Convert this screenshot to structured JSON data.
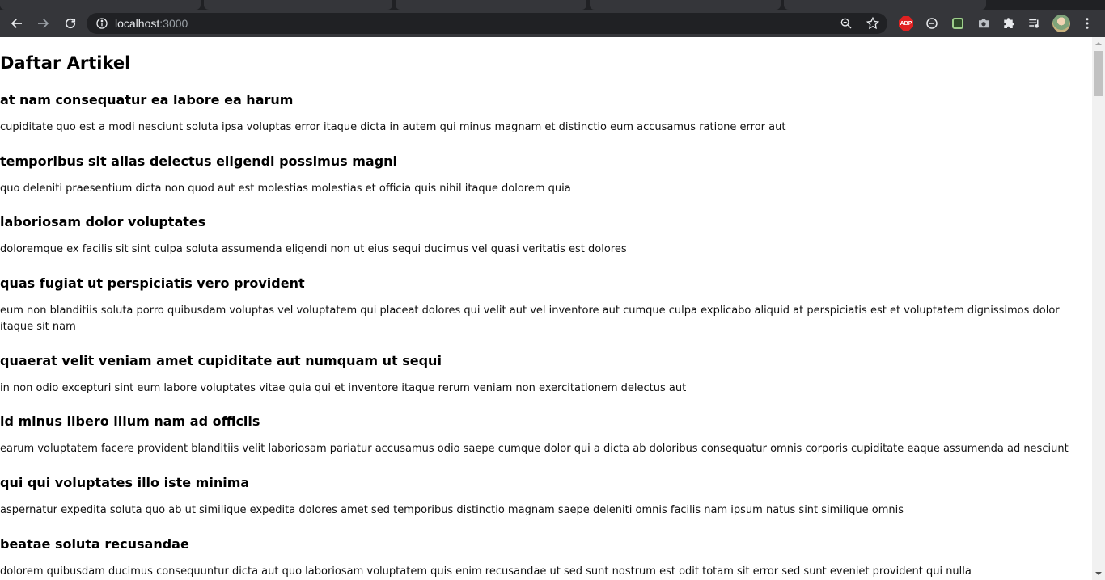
{
  "browser": {
    "url_host": "localhost",
    "url_port": ":3000"
  },
  "page": {
    "title": "Daftar Artikel",
    "articles": [
      {
        "title": "at nam consequatur ea labore ea harum",
        "body": "cupiditate quo est a modi nesciunt soluta ipsa voluptas error itaque dicta in autem qui minus magnam et distinctio eum accusamus ratione error aut"
      },
      {
        "title": "temporibus sit alias delectus eligendi possimus magni",
        "body": "quo deleniti praesentium dicta non quod aut est molestias molestias et officia quis nihil itaque dolorem quia"
      },
      {
        "title": "laboriosam dolor voluptates",
        "body": "doloremque ex facilis sit sint culpa soluta assumenda eligendi non ut eius sequi ducimus vel quasi veritatis est dolores"
      },
      {
        "title": "quas fugiat ut perspiciatis vero provident",
        "body": "eum non blanditiis soluta porro quibusdam voluptas vel voluptatem qui placeat dolores qui velit aut vel inventore aut cumque culpa explicabo aliquid at perspiciatis est et voluptatem dignissimos dolor itaque sit nam"
      },
      {
        "title": "quaerat velit veniam amet cupiditate aut numquam ut sequi",
        "body": "in non odio excepturi sint eum labore voluptates vitae quia qui et inventore itaque rerum veniam non exercitationem delectus aut"
      },
      {
        "title": "id minus libero illum nam ad officiis",
        "body": "earum voluptatem facere provident blanditiis velit laboriosam pariatur accusamus odio saepe cumque dolor qui a dicta ab doloribus consequatur omnis corporis cupiditate eaque assumenda ad nesciunt"
      },
      {
        "title": "qui qui voluptates illo iste minima",
        "body": "aspernatur expedita soluta quo ab ut similique expedita dolores amet sed temporibus distinctio magnam saepe deleniti omnis facilis nam ipsum natus sint similique omnis"
      },
      {
        "title": "beatae soluta recusandae",
        "body": "dolorem quibusdam ducimus consequuntur dicta aut quo laboriosam voluptatem quis enim recusandae ut sed sunt nostrum est odit totam sit error sed sunt eveniet provident qui nulla"
      }
    ]
  }
}
